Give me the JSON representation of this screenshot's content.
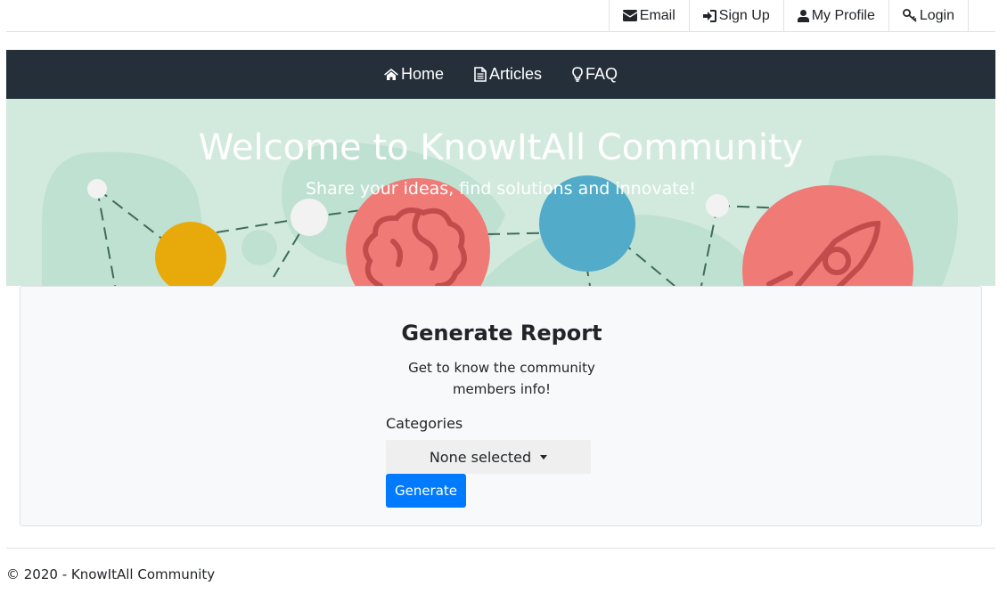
{
  "top_links": {
    "email": {
      "label": "Email",
      "icon": "envelope-icon"
    },
    "sign_up": {
      "label": "Sign Up",
      "icon": "sign-in-icon"
    },
    "my_profile": {
      "label": "My Profile",
      "icon": "user-icon"
    },
    "login": {
      "label": "Login",
      "icon": "key-icon"
    }
  },
  "nav": {
    "home": {
      "label": "Home",
      "icon": "home-icon"
    },
    "articles": {
      "label": "Articles",
      "icon": "file-icon"
    },
    "faq": {
      "label": "FAQ",
      "icon": "lightbulb-icon"
    }
  },
  "hero": {
    "title": "Welcome to KnowItAll Community",
    "subtitle": "Share your ideas, find solutions and innovate!"
  },
  "report": {
    "title": "Generate Report",
    "description": "Get to know the community members info!",
    "categories_label": "Categories",
    "select_value": "None selected",
    "generate_label": "Generate"
  },
  "footer": {
    "text": "© 2020 - KnowItAll Community"
  },
  "colors": {
    "nav_bg": "#252f3a",
    "hero_bg": "#d2eade",
    "primary": "#007bff",
    "coral": "#f07a76",
    "teal": "#52abc8",
    "yellow": "#e8aa0b"
  }
}
